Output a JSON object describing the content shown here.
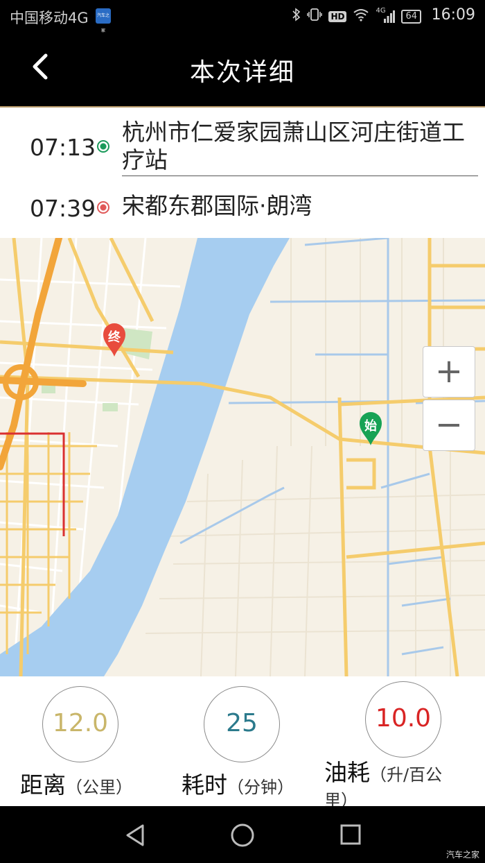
{
  "status_bar": {
    "carrier": "中国移动4G",
    "app_badge": "汽车之家",
    "hd": "HD",
    "network": "4G",
    "battery": "64",
    "time": "16:09"
  },
  "header": {
    "title": "本次详细",
    "back_icon": "chevron-left-icon"
  },
  "route": {
    "start": {
      "time": "07:13",
      "place": "杭州市仁爱家园萧山区河庄街道工疗站",
      "dot_color": "#1a9a5a"
    },
    "end": {
      "time": "07:39",
      "place": "宋都东郡国际·朗湾",
      "dot_color": "#e05858"
    }
  },
  "map": {
    "end_pin_label": "终",
    "start_pin_label": "始",
    "end_pin_color": "#e84c3d",
    "start_pin_color": "#17a255",
    "zoom_in": "+",
    "zoom_out": "−"
  },
  "stats": {
    "distance": {
      "value": "12.0",
      "label": "距离",
      "unit": "（公里）",
      "color": "#c9b66a"
    },
    "duration": {
      "value": "25",
      "label": "耗时",
      "unit": "（分钟）",
      "color": "#2b7a8c"
    },
    "fuel": {
      "value": "10.0",
      "label": "油耗",
      "unit": "（升/百公里）",
      "color": "#d92424"
    }
  },
  "bottom_nav": {
    "back_icon": "triangle-back-icon",
    "home_icon": "circle-home-icon",
    "recents_icon": "square-recents-icon"
  },
  "watermark": "汽车之家"
}
